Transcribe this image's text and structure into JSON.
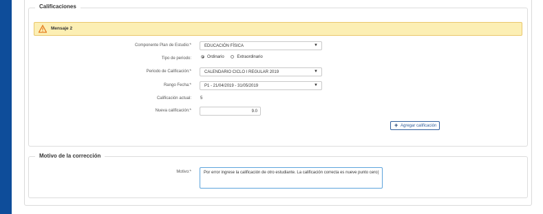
{
  "calificaciones": {
    "legend": "Calificaciones",
    "warning": "Mensaje 2",
    "componente": {
      "label": "Componente Plan de Estudio:*",
      "value": "EDUCACIÓN FÍSICA"
    },
    "tipo_periodo": {
      "label": "Tipo de periodo:",
      "option1": "Ordinario",
      "option2": "Extraordinario",
      "selected": "Ordinario"
    },
    "periodo": {
      "label": "Periodo de Calificación:*",
      "value": "CALENDARIO CICLO I REGULAR 2019"
    },
    "rango": {
      "label": "Rango Fecha:*",
      "value": "P1 - 21/04/2019 - 31/05/2019"
    },
    "actual": {
      "label": "Calificación actual:",
      "value": "5"
    },
    "nueva": {
      "label": "Nueva calificación:*",
      "value": "9.0"
    },
    "add_button": "Agregar calificación"
  },
  "motivo": {
    "legend": "Motivo de la corrección",
    "label": "Motivo:*",
    "value": "Por error ingrese la calificación de otro estudiante. La calificación correcta es nueve punto cero|"
  },
  "icons": {
    "warning": "warning-triangle-icon",
    "add": "plus-icon",
    "dropdown": "chevron-down-icon"
  },
  "colors": {
    "sidebar": "#0e4d9a",
    "warning_bg": "#fcefb4",
    "warning_icon": "#e67e22",
    "button_border": "#2c5b9a",
    "focus_border": "#5aa2db"
  }
}
